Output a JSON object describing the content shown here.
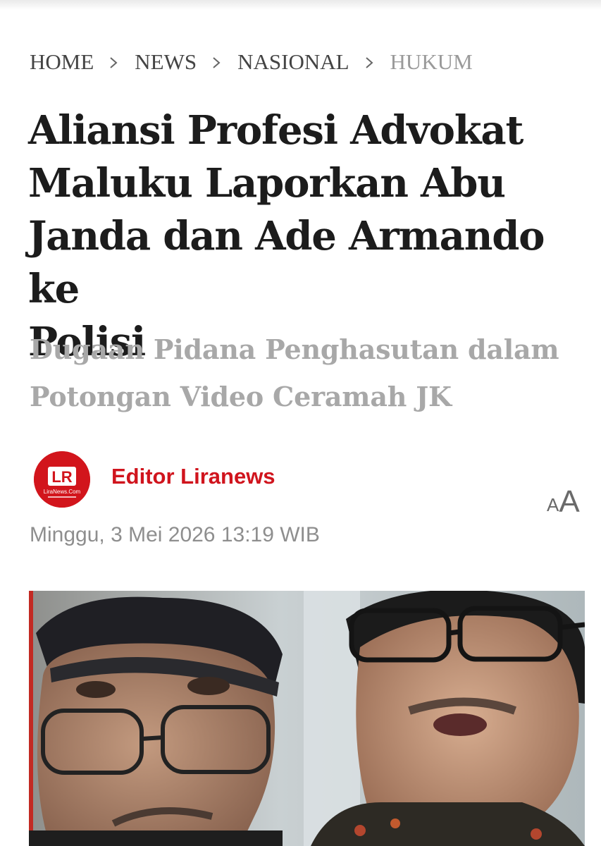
{
  "breadcrumb": {
    "items": [
      {
        "label": "HOME"
      },
      {
        "label": "NEWS"
      },
      {
        "label": "NASIONAL"
      },
      {
        "label": "HUKUM"
      }
    ]
  },
  "article": {
    "title_lines": [
      "Aliansi Profesi Advokat",
      "Maluku Laporkan Abu",
      "Janda dan Ade Armando ke",
      "Polisi"
    ],
    "subtitle_lines": [
      "Dugaan Pidana Penghasutan dalam",
      "Potongan Video Ceramah JK"
    ],
    "author": {
      "name": "Editor Liranews",
      "logo_mark": "LR",
      "logo_text": "LiraNews.Com"
    },
    "font_toggle": {
      "small": "A",
      "large": "A"
    },
    "date": "Minggu, 3 Mei 2026 13:19 WIB",
    "hero_image": {
      "icon": "photo-two-men"
    }
  },
  "colors": {
    "accent": "#d0141d",
    "title": "#1c1c1c",
    "subtitle": "#a8a8a8",
    "meta": "#8e8e8e"
  }
}
